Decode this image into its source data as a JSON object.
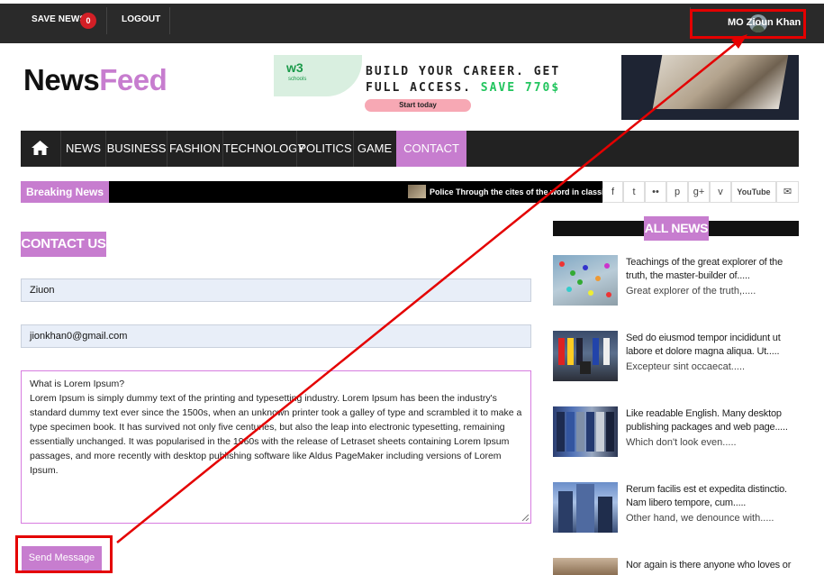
{
  "topbar": {
    "save_news": "SAVE NEWS",
    "save_count": "0",
    "logout": "LOGOUT",
    "username": "MO Zioun Khan"
  },
  "logo": {
    "part1": "News",
    "part2": "Feed"
  },
  "banner": {
    "brand": "w3",
    "brand_sub": "schools",
    "line1": "BUILD YOUR CAREER. GET",
    "line2_a": "FULL ACCESS.",
    "line2_b": "SAVE 770$",
    "button": "Start today"
  },
  "nav": {
    "items": [
      "NEWS",
      "BUSINESS",
      "FASHION",
      "TECHNOLOGY",
      "POLITICS",
      "GAME",
      "CONTACT US"
    ],
    "active": "CONTACT US"
  },
  "breaking": {
    "label": "Breaking News",
    "ticker": "Police Through the cites of the word in classical"
  },
  "social": [
    "f",
    "t",
    "••",
    "p",
    "g+",
    "v",
    "YouTube",
    "✉"
  ],
  "contact": {
    "title": "CONTACT US",
    "name_value": "Ziuon",
    "email_value": "jionkhan0@gmail.com",
    "message_value": "What is Lorem Ipsum?\nLorem Ipsum is simply dummy text of the printing and typesetting industry. Lorem Ipsum has been the industry's standard dummy text ever since the 1500s, when an unknown printer took a galley of type and scrambled it to make a type specimen book. It has survived not only five centuries, but also the leap into electronic typesetting, remaining essentially unchanged. It was popularised in the 1960s with the release of Letraset sheets containing Lorem Ipsum passages, and more recently with desktop publishing software like Aldus PageMaker including versions of Lorem Ipsum.",
    "send_label": "Send Message"
  },
  "all_news": {
    "title": "ALL NEWS",
    "items": [
      {
        "title": "Teachings of the great explorer of the truth, the master-builder of.....",
        "subtitle": "Great explorer of the truth,....."
      },
      {
        "title": "Sed do eiusmod tempor incididunt ut labore et dolore magna aliqua. Ut.....",
        "subtitle": "Excepteur sint occaecat....."
      },
      {
        "title": "Like readable English. Many desktop publishing packages and web page.....",
        "subtitle": "Which don't look even....."
      },
      {
        "title": "Rerum facilis est et expedita distinctio. Nam libero tempore, cum.....",
        "subtitle": "Other hand, we denounce with....."
      },
      {
        "title": "Nor again is there anyone who loves or",
        "subtitle": ""
      }
    ]
  },
  "colors": {
    "accent": "#c77dcf",
    "highlight": "#e40000",
    "dark": "#222222"
  }
}
